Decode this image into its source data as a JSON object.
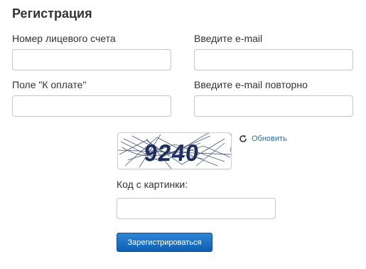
{
  "form": {
    "title": "Регистрация",
    "account_label": "Номер лицевого счета",
    "account_value": "",
    "email_label": "Введите e-mail",
    "email_value": "",
    "payment_label": "Поле \"К оплате\"",
    "payment_value": "",
    "email_repeat_label": "Введите e-mail повторно",
    "email_repeat_value": "",
    "captcha_text": "9240",
    "refresh_label": "Обновить",
    "captcha_label": "Код с картинки:",
    "captcha_value": "",
    "submit_label": "Зарегистрироваться"
  },
  "colors": {
    "button_primary": "#0f5fb1",
    "link": "#1a6fb3",
    "captcha_ink": "#1c2d5e"
  },
  "icons": {
    "refresh": "refresh-icon"
  }
}
